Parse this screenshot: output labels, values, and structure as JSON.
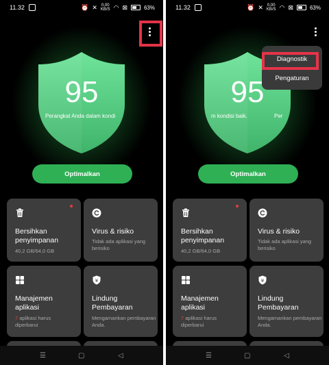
{
  "status_bar": {
    "time": "11.32",
    "battery": "63%",
    "net_speed": "0,00",
    "net_unit": "KB/S"
  },
  "score": "95",
  "shield_message_left": "Perangkat Anda dalam kondi",
  "shield_message_right_a": "m kondisi baik.",
  "shield_message_right_b": "Per",
  "optimize_label": "Optimalkan",
  "cards": {
    "storage": {
      "title_1": "Bersihkan",
      "title_2": "penyimpanan",
      "sub": "40,2 GB/64,0 GB"
    },
    "virus": {
      "title": "Virus & risiko",
      "sub_1": "Tidak ada aplikasi yang",
      "sub_2": "berisiko"
    },
    "apps": {
      "title_1": "Manajemen",
      "title_2": "aplikasi",
      "count": "7",
      "sub_1_rest": " aplikasi harus",
      "sub_2": "diperbarui"
    },
    "payment": {
      "title_1": "Lindung",
      "title_2": "Pembayaran",
      "sub": "Mengamankan pembayaran Anda."
    }
  },
  "menu": {
    "diagnostic": "Diagnostik",
    "settings": "Pengaturan"
  },
  "colors": {
    "accent_green": "#2fb055",
    "shield_green": "#5fd88a",
    "card_bg": "#3d3d3d",
    "highlight_red": "#e53348"
  }
}
